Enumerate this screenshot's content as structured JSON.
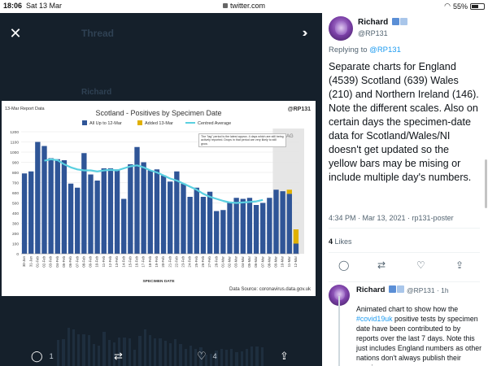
{
  "status_bar": {
    "time": "18:06",
    "date": "Sat 13 Mar",
    "url": "twitter.com",
    "battery": "55%",
    "battery_level": 0.55
  },
  "background": {
    "title": "Thread",
    "name": "Richard"
  },
  "viewer": {
    "reply_count": "1",
    "retweet_count": "",
    "like_count": "4"
  },
  "chart": {
    "report_label": "13-Mar Report Data",
    "title": "Scotland - Positives by Specimen Date",
    "watermark": "@RP131",
    "legend": {
      "all": "All Up to 12-Mar",
      "added": "Added 13-Mar",
      "avg": "Centred Average"
    },
    "note": "The \"lag\" period is the latest approx. 4 days which are still being actively reported. Drops in that period are very likely to still grow.",
    "lag_label": "LAG",
    "xlabel": "SPECIMEN DATE",
    "source": "Data Source: coronavirus.data.gov.uk"
  },
  "chart_data": {
    "type": "bar",
    "title": "Scotland - Positives by Specimen Date",
    "xlabel": "SPECIMEN DATE",
    "ylabel": "",
    "ylim": [
      0,
      1200
    ],
    "yticks": [
      0,
      100,
      200,
      300,
      400,
      500,
      600,
      700,
      800,
      900,
      1000,
      1100,
      1200
    ],
    "categories": [
      "30-Jan",
      "31-Jan",
      "01-Feb",
      "02-Feb",
      "03-Feb",
      "04-Feb",
      "05-Feb",
      "06-Feb",
      "07-Feb",
      "08-Feb",
      "09-Feb",
      "10-Feb",
      "11-Feb",
      "12-Feb",
      "13-Feb",
      "14-Feb",
      "15-Feb",
      "16-Feb",
      "17-Feb",
      "18-Feb",
      "19-Feb",
      "20-Feb",
      "21-Feb",
      "22-Feb",
      "23-Feb",
      "24-Feb",
      "25-Feb",
      "26-Feb",
      "27-Feb",
      "28-Feb",
      "01-Mar",
      "02-Mar",
      "03-Mar",
      "04-Mar",
      "05-Mar",
      "06-Mar",
      "07-Mar",
      "08-Mar",
      "09-Mar",
      "10-Mar",
      "11-Mar",
      "12-Mar"
    ],
    "series": [
      {
        "name": "All Up to 12-Mar",
        "color": "#2f5597",
        "values": [
          790,
          810,
          1100,
          1060,
          940,
          930,
          920,
          690,
          650,
          990,
          780,
          720,
          840,
          840,
          830,
          540,
          880,
          1050,
          900,
          820,
          830,
          770,
          710,
          810,
          690,
          560,
          650,
          560,
          610,
          420,
          430,
          510,
          550,
          540,
          550,
          480,
          500,
          550,
          630,
          615,
          590,
          100
        ]
      },
      {
        "name": "Added 13-Mar",
        "color": "#e0b000",
        "values": [
          0,
          0,
          0,
          0,
          0,
          0,
          0,
          0,
          0,
          0,
          0,
          0,
          0,
          0,
          0,
          0,
          0,
          0,
          0,
          0,
          0,
          0,
          0,
          0,
          0,
          0,
          0,
          0,
          0,
          0,
          0,
          0,
          0,
          0,
          0,
          0,
          0,
          0,
          0,
          0,
          40,
          140
        ]
      },
      {
        "name": "Centred Average",
        "color": "#5ad0e0",
        "values": [
          null,
          null,
          null,
          915,
          930,
          920,
          880,
          850,
          830,
          820,
          820,
          810,
          820,
          825,
          820,
          840,
          860,
          870,
          850,
          820,
          800,
          770,
          740,
          720,
          690,
          660,
          630,
          590,
          560,
          540,
          520,
          505,
          500,
          505,
          510,
          515,
          530,
          null,
          null,
          null,
          null,
          null
        ]
      }
    ],
    "lag_start_category": "09-Mar",
    "grid": true,
    "legend": "top"
  },
  "tweet": {
    "name": "Richard",
    "handle": "@RP131",
    "replying_prefix": "Replying to ",
    "replying_to": "@RP131",
    "text": "Separate charts for England (4539) Scotland (639) Wales (210) and Northern Ireland (146). Note the different scales. Also on certain days the specimen-date data for Scotland/Wales/NI doesn't get updated so the yellow bars may be mising or include multiple day's numbers.",
    "time": "4:34 PM · Mar 13, 2021 · rp131-poster",
    "likes_count": "4",
    "likes_label": "Likes"
  },
  "reply": {
    "name": "Richard",
    "handle": "@RP131 · 1h",
    "text_before": "Animated chart to show how the ",
    "hashtag": "#covid19uk",
    "text_after": " positive tests by specimen date have been contributed to by reports over the last 7 days. Note this just includes England numbers as other nations don't always publish their specimen"
  },
  "colors": {
    "accent": "#1d9bf0",
    "viewer_bg": "#15202b",
    "bar_blue": "#2f5597",
    "bar_gold": "#e0b000",
    "avg_line": "#5ad0e0"
  }
}
